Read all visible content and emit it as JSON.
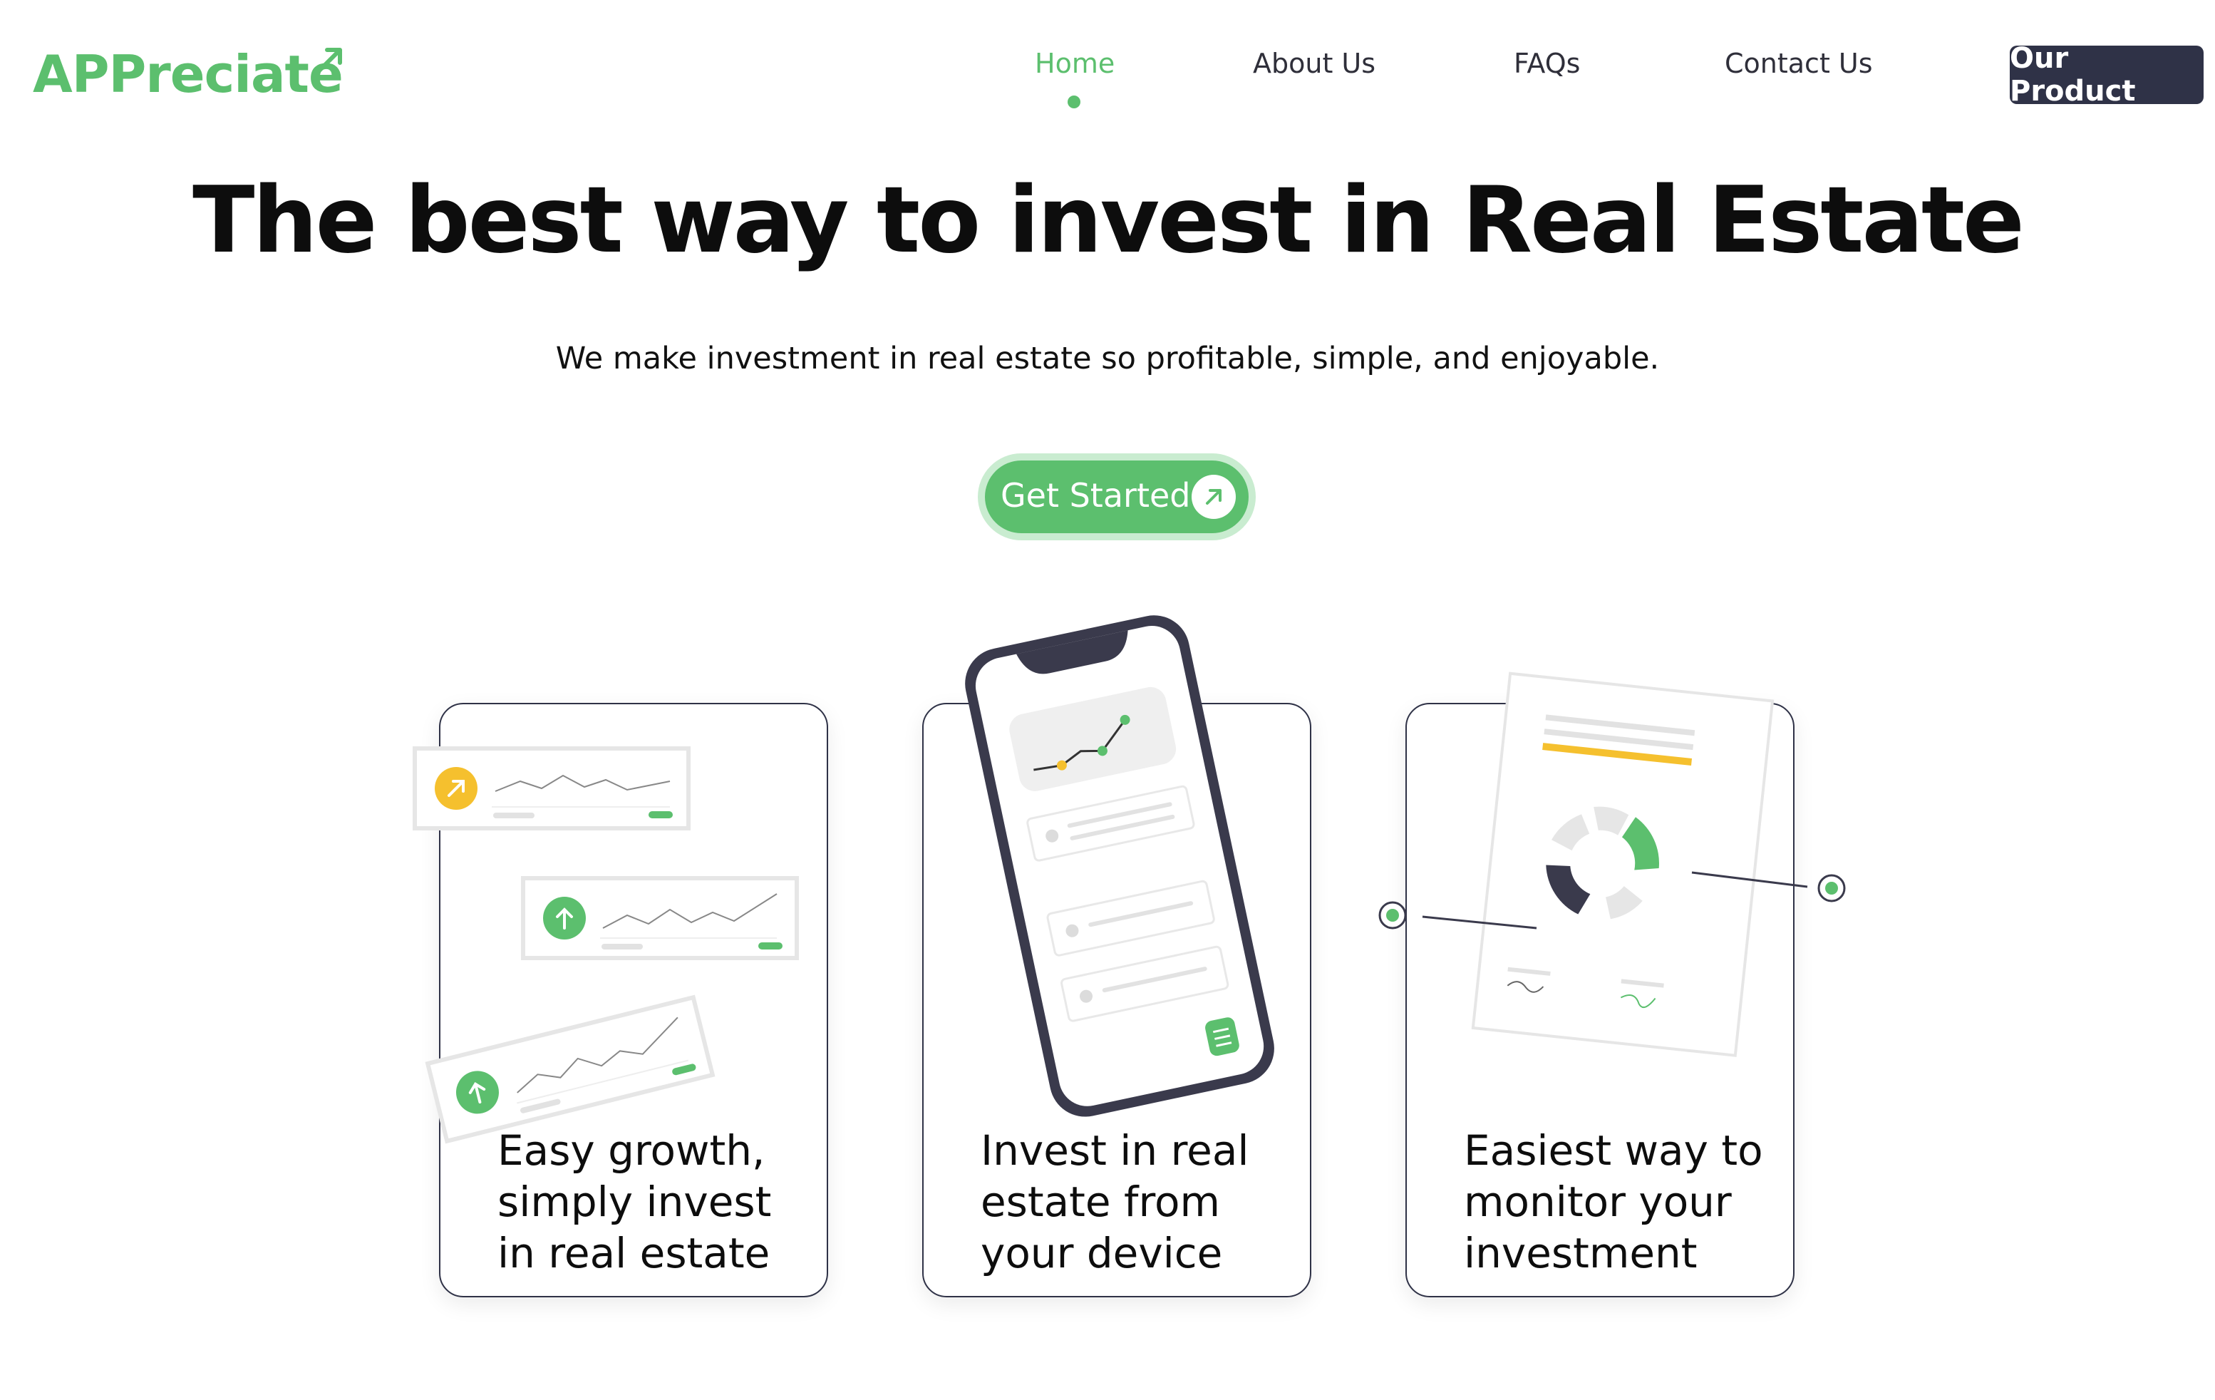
{
  "brand": {
    "name": "APPreciate",
    "color": "#5cbf6e"
  },
  "nav": {
    "items": [
      {
        "label": "Home",
        "active": true
      },
      {
        "label": "About Us",
        "active": false
      },
      {
        "label": "FAQs",
        "active": false
      },
      {
        "label": "Contact Us",
        "active": false
      }
    ],
    "product_button": "Our Product"
  },
  "hero": {
    "title": "The best way to invest in Real Estate",
    "subtitle": "We make investment in real estate so profitable, simple, and enjoyable.",
    "cta_label": "Get Started",
    "cta_icon": "arrow-up-right-icon"
  },
  "cards": [
    {
      "text": "Easy growth, simply invest in real estate",
      "illustration": "growth-charts"
    },
    {
      "text": "Invest in real estate from your device",
      "illustration": "smartphone"
    },
    {
      "text": "Easiest way to monitor your investment",
      "illustration": "report-document"
    }
  ],
  "colors": {
    "accent": "#5cbf6e",
    "dark": "#2f3247",
    "yellow": "#f5c02e"
  }
}
